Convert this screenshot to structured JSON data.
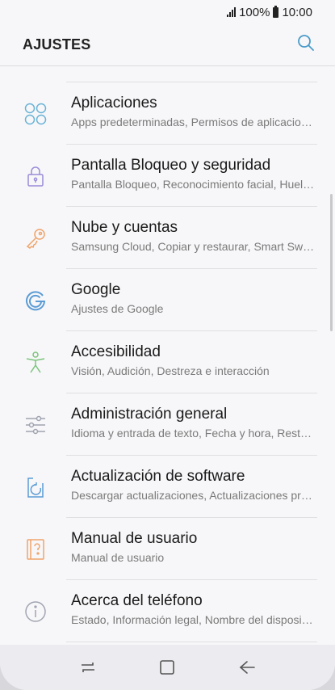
{
  "status": {
    "battery_pct": "100%",
    "time": "10:00"
  },
  "header": {
    "title": "AJUSTES"
  },
  "items": [
    {
      "title": "Aplicaciones",
      "subtitle": "Apps predeterminadas, Permisos de aplicaciones",
      "icon": "apps-icon",
      "color": "#6ab3d6"
    },
    {
      "title": "Pantalla Bloqueo y seguridad",
      "subtitle": "Pantalla Bloqueo, Reconocimiento facial, Huella digital",
      "icon": "lock-icon",
      "color": "#9b8bd8"
    },
    {
      "title": "Nube y cuentas",
      "subtitle": "Samsung Cloud, Copiar y restaurar, Smart Switch",
      "icon": "key-icon",
      "color": "#f0a36a"
    },
    {
      "title": "Google",
      "subtitle": "Ajustes de Google",
      "icon": "google-icon",
      "color": "#5b9bd5"
    },
    {
      "title": "Accesibilidad",
      "subtitle": "Visión, Audición, Destreza e interacción",
      "icon": "accessibility-icon",
      "color": "#7cc47c"
    },
    {
      "title": "Administración general",
      "subtitle": "Idioma y entrada de texto, Fecha y hora, Restablecer",
      "icon": "sliders-icon",
      "color": "#a0a4b0"
    },
    {
      "title": "Actualización de software",
      "subtitle": "Descargar actualizaciones, Actualizaciones programadas",
      "icon": "software-update-icon",
      "color": "#5b9bd5"
    },
    {
      "title": "Manual de usuario",
      "subtitle": "Manual de usuario",
      "icon": "manual-icon",
      "color": "#f0a36a"
    },
    {
      "title": "Acerca del teléfono",
      "subtitle": "Estado, Información legal, Nombre del dispositivo",
      "icon": "info-icon",
      "color": "#a0a4b0"
    }
  ]
}
